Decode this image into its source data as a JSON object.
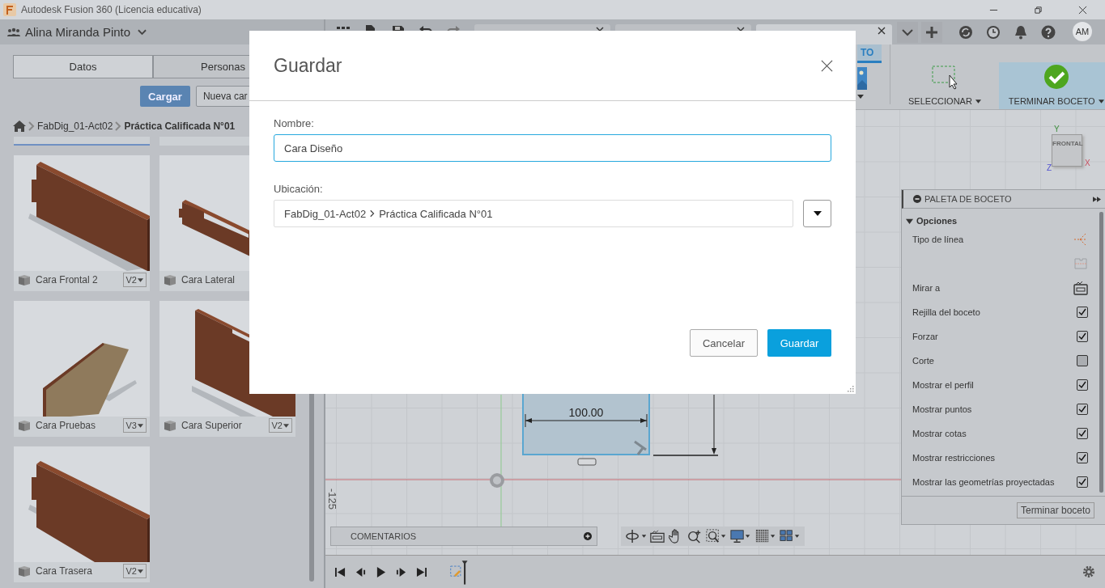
{
  "window": {
    "title": "Autodesk Fusion 360 (Licencia educativa)"
  },
  "data_panel": {
    "user": "Alina Miranda Pinto",
    "tabs": [
      {
        "label": "Datos",
        "selected": true
      },
      {
        "label": "Personas",
        "selected": false
      }
    ],
    "upload_button": "Cargar",
    "new_folder_button": "Nueva car",
    "breadcrumb": [
      {
        "label": "FabDig_01-Act02",
        "current": false
      },
      {
        "label": "Práctica Calificada N°01",
        "current": true
      }
    ],
    "items": [
      {
        "name": "Cara Frontal 2",
        "version": "V2"
      },
      {
        "name": "Cara Lateral"
      },
      {
        "name": "Cara Pruebas",
        "version": "V3"
      },
      {
        "name": "Cara Superior",
        "version": "V2"
      },
      {
        "name": "Cara Trasera",
        "version": "V2"
      }
    ]
  },
  "document_tabs": [
    {
      "selected": false
    },
    {
      "selected": false
    },
    {
      "selected": true
    }
  ],
  "user_initials": "AM",
  "ribbon": {
    "tab_label": "TO",
    "tools": [
      {
        "kind": "select",
        "label": "SELECCIONAR"
      },
      {
        "kind": "finish",
        "label": "TERMINAR BOCETO"
      }
    ]
  },
  "view_cube": {
    "face": "FRONTAL",
    "axes": [
      {
        "kind": "y",
        "label": "Y"
      },
      {
        "kind": "x",
        "label": "X"
      },
      {
        "kind": "z",
        "label": "Z"
      }
    ]
  },
  "sketch": {
    "dimension": "100.00",
    "ruler_label": "-125"
  },
  "palette": {
    "title": "PALETA DE BOCETO",
    "section": "Opciones",
    "expanded": true,
    "rows": [
      {
        "kind": "linetype",
        "label": "Tipo de línea"
      },
      {
        "kind": "construction"
      },
      {
        "kind": "look-at",
        "label": "Mirar a"
      },
      {
        "kind": "checkbox",
        "label": "Rejilla del boceto",
        "checked": true
      },
      {
        "kind": "checkbox",
        "label": "Forzar",
        "checked": true
      },
      {
        "kind": "checkbox",
        "label": "Corte",
        "checked": false
      },
      {
        "kind": "checkbox",
        "label": "Mostrar el perfil",
        "checked": true
      },
      {
        "kind": "checkbox",
        "label": "Mostrar puntos",
        "checked": true
      },
      {
        "kind": "checkbox",
        "label": "Mostrar cotas",
        "checked": true
      },
      {
        "kind": "checkbox",
        "label": "Mostrar restricciones",
        "checked": true
      },
      {
        "kind": "checkbox",
        "label": "Mostrar las geometrías proyectadas",
        "checked": true
      }
    ],
    "finish_button": "Terminar boceto"
  },
  "comments": {
    "label": "COMENTARIOS"
  },
  "dialog": {
    "title": "Guardar",
    "name_label": "Nombre:",
    "name_value": "Cara Diseño",
    "location_label": "Ubicación:",
    "location_path": [
      "FabDig_01-Act02",
      "Práctica Calificada N°01"
    ],
    "cancel_button": "Cancelar",
    "save_button": "Guardar"
  }
}
